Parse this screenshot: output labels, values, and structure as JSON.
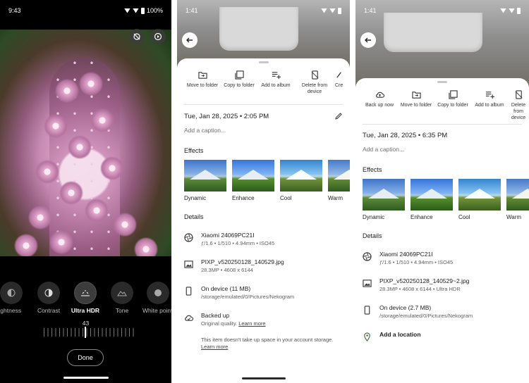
{
  "screen1": {
    "status_time": "9:43",
    "status_battery": "100%",
    "tools": [
      {
        "label": "Brightness",
        "icon": "brightness-icon"
      },
      {
        "label": "Contrast",
        "icon": "contrast-icon"
      },
      {
        "label": "Ultra HDR",
        "icon": "ultra-hdr-icon"
      },
      {
        "label": "Tone",
        "icon": "tone-icon"
      },
      {
        "label": "White point",
        "icon": "white-point-icon"
      }
    ],
    "slider_value": "43",
    "done_label": "Done"
  },
  "screen2": {
    "status_time": "1:41",
    "actions": [
      "Move to folder",
      "Copy to folder",
      "Add to album",
      "Delete from device",
      "Cre"
    ],
    "date": "Tue, Jan 28, 2025 • 2:05 PM",
    "caption_placeholder": "Add a caption...",
    "effects_title": "Effects",
    "effects": [
      "Dynamic",
      "Enhance",
      "Cool",
      "Warm"
    ],
    "details_title": "Details",
    "camera": "Xiaomi 24069PC21I",
    "camera_specs": "ƒ/1.6 • 1/510 • 4.94mm • ISO45",
    "file_name": "PIXP_v520250128_140529.jpg",
    "file_specs": "28.3MP • 4608 x 6144",
    "storage_title": "On device (11 MB)",
    "storage_path": "/storage/emulated/0/Pictures/Nekogram",
    "backup_title": "Backed up",
    "backup_sub": "Original quality.",
    "learn_more": "Learn more",
    "space_note": "This item doesn't take up space in your account storage.",
    "learn_more2": "Learn more"
  },
  "screen3": {
    "status_time": "1:41",
    "actions": [
      "Back up now",
      "Move to folder",
      "Copy to folder",
      "Add to album",
      "Delete from device"
    ],
    "date": "Tue, Jan 28, 2025 • 6:35 PM",
    "caption_placeholder": "Add a caption...",
    "effects_title": "Effects",
    "effects": [
      "Dynamic",
      "Enhance",
      "Cool",
      "Warm"
    ],
    "details_title": "Details",
    "camera": "Xiaomi 24069PC21I",
    "camera_specs": "ƒ/1.6 • 1/510 • 4.94mm • ISO45",
    "file_name": "PIXP_v520250128_140529~2.jpg",
    "file_specs": "28.3MP • 4608 x 6144 • Ultra HDR",
    "storage_title": "On device (2.7 MB)",
    "storage_path": "/storage/emulated/0/Pictures/Nekogram",
    "location": "Add a location"
  }
}
